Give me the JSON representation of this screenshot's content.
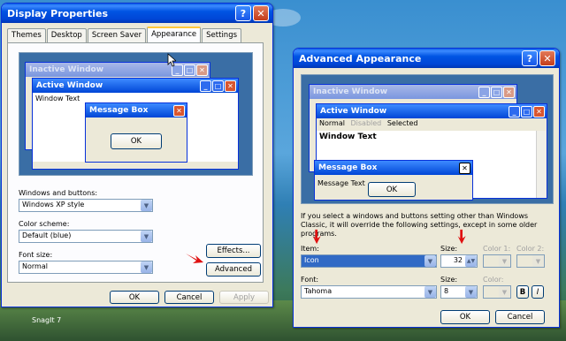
{
  "display_properties": {
    "title": "Display Properties",
    "tabs": [
      "Themes",
      "Desktop",
      "Screen Saver",
      "Appearance",
      "Settings"
    ],
    "active_tab": "Appearance",
    "preview": {
      "inactive_window": "Inactive Window",
      "active_window": "Active Window",
      "window_text": "Window Text",
      "message_box": "Message Box",
      "ok": "OK"
    },
    "windows_and_buttons_label": "Windows and buttons:",
    "windows_and_buttons_value": "Windows XP style",
    "color_scheme_label": "Color scheme:",
    "color_scheme_value": "Default (blue)",
    "font_size_label": "Font size:",
    "font_size_value": "Normal",
    "effects_button": "Effects...",
    "advanced_button": "Advanced",
    "ok_button": "OK",
    "cancel_button": "Cancel",
    "apply_button": "Apply"
  },
  "advanced_appearance": {
    "title": "Advanced Appearance",
    "preview": {
      "inactive_window": "Inactive Window",
      "active_window": "Active Window",
      "menu_normal": "Normal",
      "menu_disabled": "Disabled",
      "menu_selected": "Selected",
      "window_text": "Window Text",
      "message_box": "Message Box",
      "message_text": "Message Text",
      "ok": "OK"
    },
    "info_text": "If you select a windows and buttons setting other than Windows Classic, it will override the following settings, except in some older programs.",
    "item_label": "Item:",
    "item_value": "Icon",
    "size_label": "Size:",
    "size_value": "32",
    "color1_label": "Color 1:",
    "color2_label": "Color 2:",
    "font_label": "Font:",
    "font_value": "Tahoma",
    "font_size_label": "Size:",
    "font_size_value": "8",
    "color_label": "Color:",
    "bold_label": "B",
    "italic_label": "I",
    "ok_button": "OK",
    "cancel_button": "Cancel"
  },
  "taskbar": {
    "label": "SnagIt 7"
  },
  "colors": {
    "title_blue": "#0054e3",
    "annotation_red": "#e01010",
    "face": "#ece9d8"
  }
}
